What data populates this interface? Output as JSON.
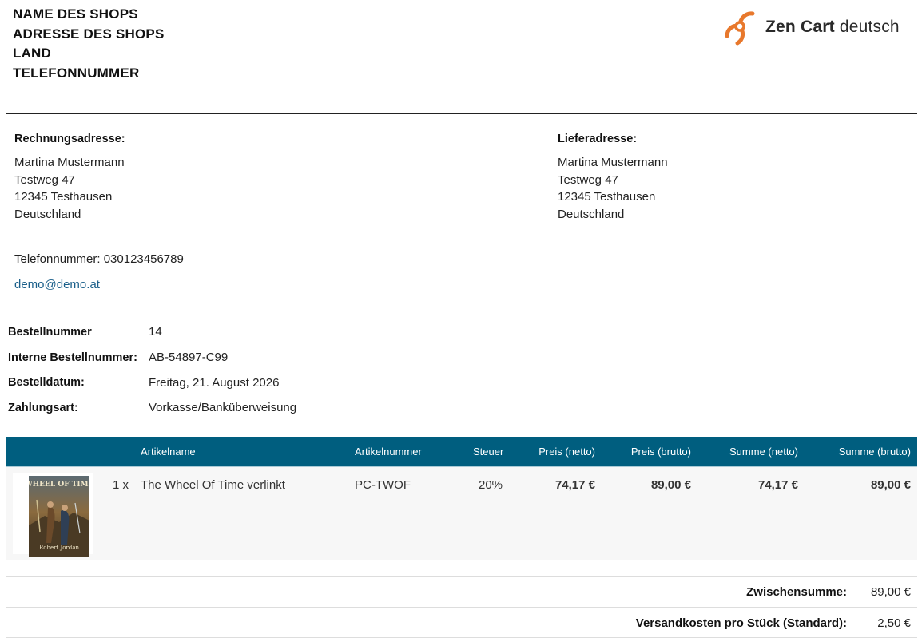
{
  "shop": {
    "name": "NAME DES SHOPS",
    "address": "ADRESSE DES SHOPS",
    "country": "LAND",
    "phone": "TELEFONNUMMER"
  },
  "logo": {
    "brand": "Zen Cart",
    "suffix": "deutsch",
    "icon": "zen-cart-swirl-icon",
    "color": "#e8782c"
  },
  "billing": {
    "title": "Rechnungsadresse:",
    "lines": [
      "Martina Mustermann",
      "Testweg 47",
      "12345 Testhausen",
      "Deutschland"
    ]
  },
  "shipping": {
    "title": "Lieferadresse:",
    "lines": [
      "Martina Mustermann",
      "Testweg 47",
      "12345 Testhausen",
      "Deutschland"
    ]
  },
  "contact": {
    "phone": "Telefonnummer: 030123456789",
    "email": "demo@demo.at"
  },
  "order_meta": [
    {
      "label": "Bestellnummer",
      "value": "14"
    },
    {
      "label": "Interne Bestellnummer:",
      "value": "AB-54897-C99"
    },
    {
      "label": "Bestelldatum:",
      "value": "Freitag, 21. August 2026"
    },
    {
      "label": "Zahlungsart:",
      "value": "Vorkasse/Banküberweisung"
    }
  ],
  "products_table": {
    "header_color": "#005e7f",
    "columns": [
      "Artikelname",
      "Artikelnummer",
      "Steuer",
      "Preis (netto)",
      "Preis (brutto)",
      "Summe (netto)",
      "Summe (brutto)"
    ],
    "rows": [
      {
        "qty": "1 x",
        "name": "The Wheel Of Time verlinkt",
        "model": "PC-TWOF",
        "tax": "20%",
        "price_net": "74,17 €",
        "price_gross": "89,00 €",
        "total_net": "74,17 €",
        "total_gross": "89,00 €",
        "image": {
          "title": "WHEEL OF TIME",
          "author": "Robert Jordan"
        }
      }
    ]
  },
  "totals": [
    {
      "label": "Zwischensumme:",
      "value": "89,00 €"
    },
    {
      "label": "Versandkosten pro Stück (Standard):",
      "value": "2,50 €"
    }
  ]
}
